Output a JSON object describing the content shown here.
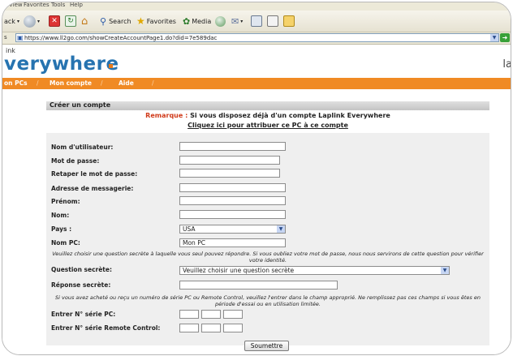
{
  "browser": {
    "menu": [
      "View",
      "Favorites",
      "Tools",
      "Help"
    ],
    "toolbar": {
      "back_label": "ack",
      "search_label": "Search",
      "favorites_label": "Favorites",
      "media_label": "Media"
    },
    "address": {
      "label": "s",
      "url": "https://www.ll2go.com/showCreateAccountPage1.do?did=7e589dac"
    }
  },
  "brand": {
    "small": "ink",
    "name": "verywhere",
    "right": "la"
  },
  "nav": {
    "items": [
      "on PCs",
      "Mon compte",
      "Aide"
    ]
  },
  "form": {
    "section_title": "Créer un compte",
    "remark_label": "Remarque :",
    "remark_text": " Si vous disposez déjà d'un compte Laplink Everywhere",
    "claim_link": "Cliquez ici pour attribuer ce PC à ce compte",
    "labels": {
      "username": "Nom d'utilisateur:",
      "password": "Mot de passe:",
      "password_confirm": "Retaper le mot de passe:",
      "email": "Adresse de messagerie:",
      "firstname": "Prénom:",
      "lastname": "Nom:",
      "country": "Pays :",
      "pc_name": "Nom PC:",
      "secret_question": "Question secrète:",
      "secret_answer": "Réponse secrète:",
      "pc_serial": "Entrer N° série PC:",
      "rc_serial": "Entrer N° série Remote Control:"
    },
    "values": {
      "country": "USA",
      "pc_name": "Mon PC",
      "secret_question": "Veuillez choisir une question secrète"
    },
    "note_secret": "Veuillez choisir une question secrète à laquelle vous seul pouvez répondre. Si vous oubliez votre mot de passe, nous nous servirons de cette question pour vérifier votre identité.",
    "note_serial": "Si vous avez acheté ou reçu un numéro de série PC ou Remote Control, veuillez l'entrer dans le champ approprié. Ne remplissez pas ces champs si vous êtes en période d'essai ou en utilisation limitée.",
    "submit_label": "Soumettre"
  }
}
